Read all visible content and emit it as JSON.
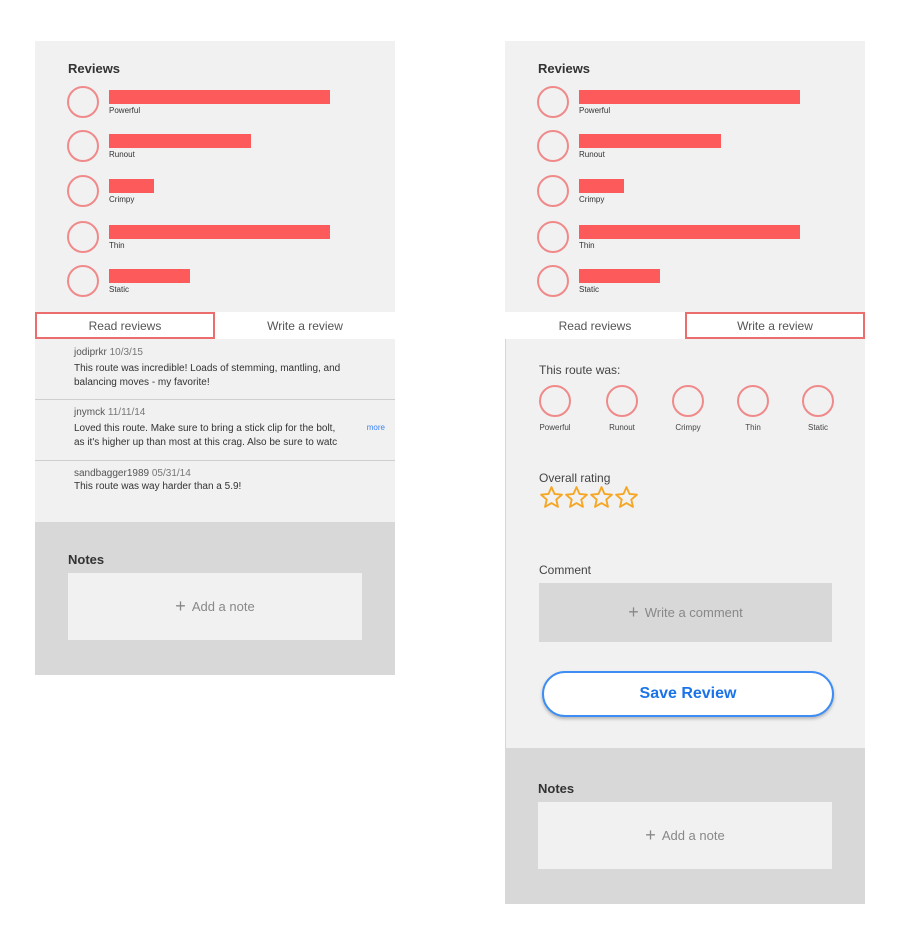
{
  "left": {
    "reviews_title": "Reviews",
    "attributes": [
      {
        "label": "Powerful",
        "fill": 0.98
      },
      {
        "label": "Runout",
        "fill": 0.63
      },
      {
        "label": "Crimpy",
        "fill": 0.2
      },
      {
        "label": "Thin",
        "fill": 0.98
      },
      {
        "label": "Static",
        "fill": 0.36
      }
    ],
    "tabs": {
      "read": "Read reviews",
      "write": "Write a review",
      "active": "read"
    },
    "reviews": [
      {
        "user": "jodiprkr",
        "date": "10/3/15",
        "lines": [
          "This route was incredible! Loads of stemming, mantling, and",
          "balancing moves - my favorite!"
        ]
      },
      {
        "user": "jnymck",
        "date": "11/11/14",
        "lines": [
          "Loved this route. Make sure to bring a stick clip for the bolt,",
          "as it's higher up than most at this crag. Also be sure to watc"
        ],
        "more": "more"
      },
      {
        "user": "sandbagger1989",
        "date": "05/31/14",
        "lines": [
          "This route was way harder than a 5.9!"
        ]
      }
    ],
    "notes_title": "Notes",
    "add_note": "Add a note"
  },
  "right": {
    "reviews_title": "Reviews",
    "attributes": [
      {
        "label": "Powerful",
        "fill": 0.98
      },
      {
        "label": "Runout",
        "fill": 0.63
      },
      {
        "label": "Crimpy",
        "fill": 0.2
      },
      {
        "label": "Thin",
        "fill": 0.98
      },
      {
        "label": "Static",
        "fill": 0.36
      }
    ],
    "tabs": {
      "read": "Read reviews",
      "write": "Write a review",
      "active": "write"
    },
    "route_was_label": "This route was:",
    "choices": [
      "Powerful",
      "Runout",
      "Crimpy",
      "Thin",
      "Static"
    ],
    "overall_rating_label": "Overall rating",
    "rating": {
      "filled": 0,
      "max": 4
    },
    "comment_label": "Comment",
    "comment_placeholder": "Write a comment",
    "save_label": "Save Review",
    "notes_title": "Notes",
    "add_note": "Add a note"
  },
  "colors": {
    "bar": "#fd5b5b",
    "circle": "#f08a8a",
    "star": "#f5a623",
    "accent": "#1a73e8"
  }
}
